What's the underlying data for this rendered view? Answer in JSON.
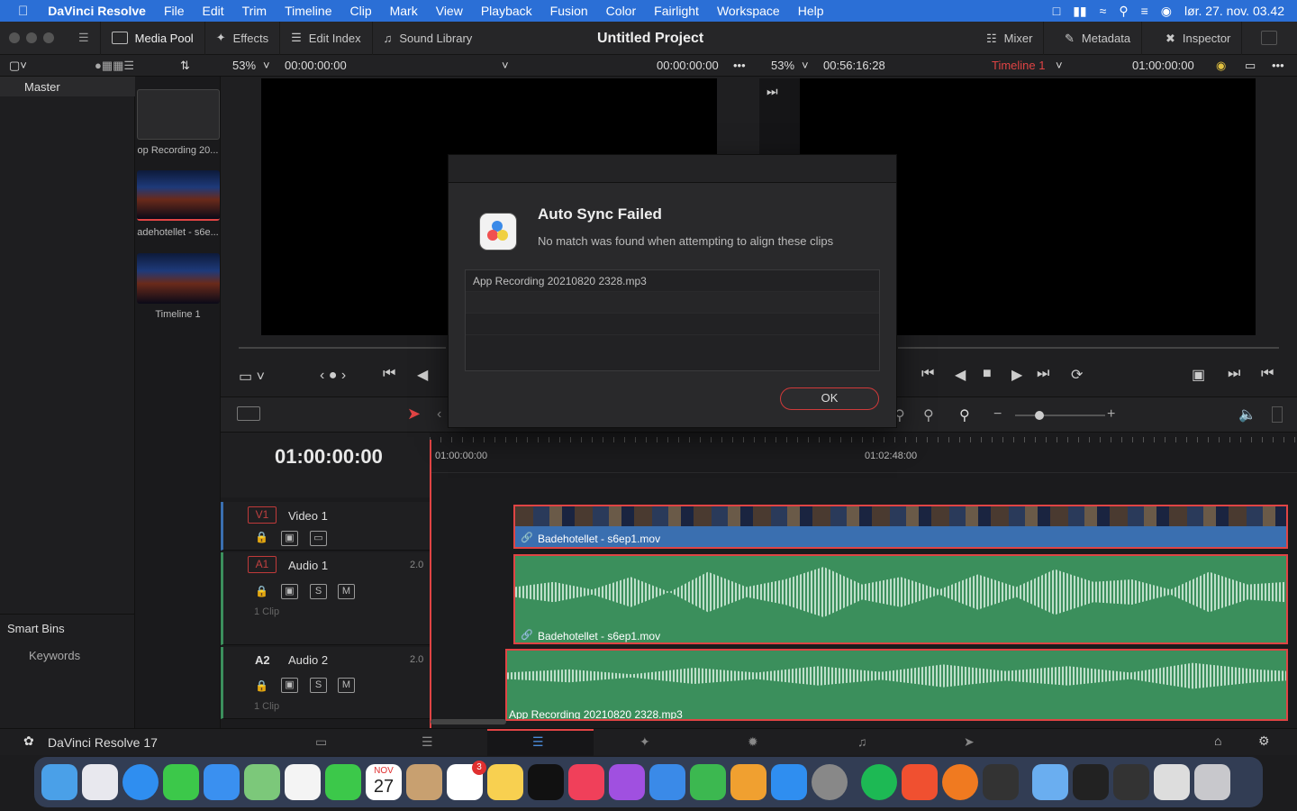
{
  "menubar": {
    "app": "DaVinci Resolve",
    "items": [
      "File",
      "Edit",
      "Trim",
      "Timeline",
      "Clip",
      "Mark",
      "View",
      "Playback",
      "Fusion",
      "Color",
      "Fairlight",
      "Workspace",
      "Help"
    ],
    "datetime": "lør. 27. nov. 03.42"
  },
  "toolbar": {
    "media_pool": "Media Pool",
    "effects": "Effects",
    "edit_index": "Edit Index",
    "sound_library": "Sound Library",
    "project_title": "Untitled Project",
    "mixer": "Mixer",
    "metadata": "Metadata",
    "inspector": "Inspector"
  },
  "viewer": {
    "src_zoom": "53%",
    "src_tc_left": "00:00:00:00",
    "src_tc_right": "00:00:00:00",
    "tl_zoom": "53%",
    "tl_duration": "00:56:16:28",
    "timeline_name": "Timeline 1",
    "tl_tc": "01:00:00:00"
  },
  "left": {
    "master": "Master",
    "smart_bins": "Smart Bins",
    "keywords": "Keywords"
  },
  "media": [
    {
      "label": "op Recording 20..."
    },
    {
      "label": "adehotellet - s6e..."
    },
    {
      "label": "Timeline 1"
    }
  ],
  "timeline": {
    "timecode": "01:00:00:00",
    "ruler_start": "01:00:00:00",
    "ruler_mid": "01:02:48:00",
    "tracks": [
      {
        "tag": "V1",
        "name": "Video 1",
        "clip": "Badehotellet - s6ep1.mov"
      },
      {
        "tag": "A1",
        "name": "Audio 1",
        "ch": "2.0",
        "count": "1 Clip",
        "clip": "Badehotellet - s6ep1.mov"
      },
      {
        "tag": "A2",
        "name": "Audio 2",
        "ch": "2.0",
        "count": "1 Clip",
        "clip": "App Recording 20210820 2328.mp3"
      }
    ]
  },
  "pagebar": {
    "label": "DaVinci Resolve 17"
  },
  "dock": {
    "calendar_month": "NOV",
    "calendar_day": "27",
    "reminders_badge": "3"
  },
  "dialog": {
    "title": "Auto Sync Failed",
    "message": "No match was found when attempting to align these clips",
    "items": [
      "App Recording 20210820 2328.mp3"
    ],
    "ok": "OK"
  }
}
